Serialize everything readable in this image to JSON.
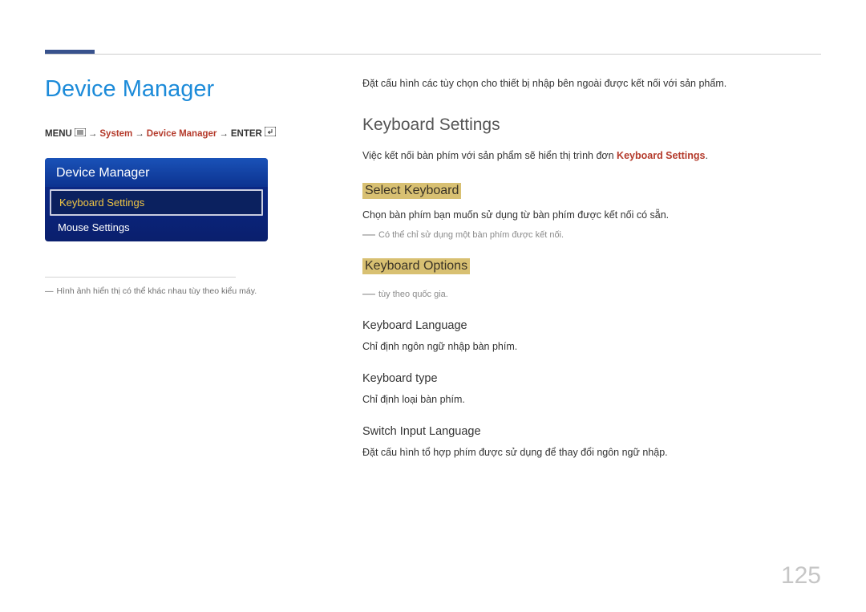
{
  "page": {
    "title": "Device Manager",
    "number": "125"
  },
  "breadcrumb": {
    "menu": "MENU",
    "arrow": "→",
    "system": "System",
    "device_manager": "Device Manager",
    "enter": "ENTER"
  },
  "osd": {
    "header": "Device Manager",
    "item_selected": "Keyboard Settings",
    "item_2": "Mouse Settings"
  },
  "left_note": {
    "text": "Hình ảnh hiển thị có thể khác nhau tùy theo kiểu máy."
  },
  "right": {
    "intro": "Đặt cấu hình các tùy chọn cho thiết bị nhập bên ngoài được kết nối với sản phẩm.",
    "h2_1": "Keyboard Settings",
    "p1_a": "Việc kết nối bàn phím với sản phẩm sẽ hiển thị trình đơn ",
    "p1_b": "Keyboard Settings",
    "p1_c": ".",
    "h3_1": "Select Keyboard",
    "p2": "Chọn bàn phím bạn muốn sử dụng từ bàn phím được kết nối có sẵn.",
    "note1": "Có thể chỉ sử dụng một bàn phím được kết nối.",
    "h3_2": "Keyboard Options",
    "note2": "tùy theo quốc gia.",
    "h4_1": "Keyboard Language",
    "p3": "Chỉ định ngôn ngữ nhập bàn phím.",
    "h4_2": "Keyboard type",
    "p4": "Chỉ định loại bàn phím.",
    "h4_3": "Switch Input Language",
    "p5": "Đặt cấu hình tổ hợp phím được sử dụng để thay đổi ngôn ngữ nhập."
  }
}
